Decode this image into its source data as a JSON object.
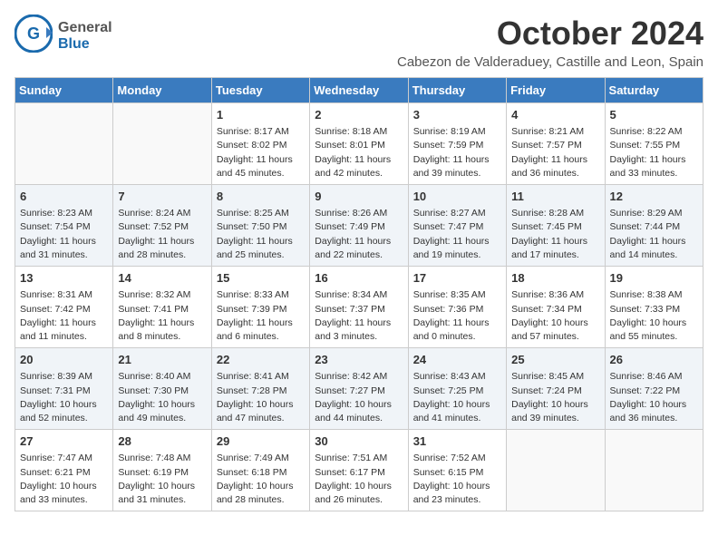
{
  "header": {
    "logo_general": "General",
    "logo_blue": "Blue",
    "title": "October 2024",
    "subtitle": "Cabezon de Valderaduey, Castille and Leon, Spain"
  },
  "days_of_week": [
    "Sunday",
    "Monday",
    "Tuesday",
    "Wednesday",
    "Thursday",
    "Friday",
    "Saturday"
  ],
  "weeks": [
    [
      {
        "day": "",
        "info": ""
      },
      {
        "day": "",
        "info": ""
      },
      {
        "day": "1",
        "info": "Sunrise: 8:17 AM\nSunset: 8:02 PM\nDaylight: 11 hours and 45 minutes."
      },
      {
        "day": "2",
        "info": "Sunrise: 8:18 AM\nSunset: 8:01 PM\nDaylight: 11 hours and 42 minutes."
      },
      {
        "day": "3",
        "info": "Sunrise: 8:19 AM\nSunset: 7:59 PM\nDaylight: 11 hours and 39 minutes."
      },
      {
        "day": "4",
        "info": "Sunrise: 8:21 AM\nSunset: 7:57 PM\nDaylight: 11 hours and 36 minutes."
      },
      {
        "day": "5",
        "info": "Sunrise: 8:22 AM\nSunset: 7:55 PM\nDaylight: 11 hours and 33 minutes."
      }
    ],
    [
      {
        "day": "6",
        "info": "Sunrise: 8:23 AM\nSunset: 7:54 PM\nDaylight: 11 hours and 31 minutes."
      },
      {
        "day": "7",
        "info": "Sunrise: 8:24 AM\nSunset: 7:52 PM\nDaylight: 11 hours and 28 minutes."
      },
      {
        "day": "8",
        "info": "Sunrise: 8:25 AM\nSunset: 7:50 PM\nDaylight: 11 hours and 25 minutes."
      },
      {
        "day": "9",
        "info": "Sunrise: 8:26 AM\nSunset: 7:49 PM\nDaylight: 11 hours and 22 minutes."
      },
      {
        "day": "10",
        "info": "Sunrise: 8:27 AM\nSunset: 7:47 PM\nDaylight: 11 hours and 19 minutes."
      },
      {
        "day": "11",
        "info": "Sunrise: 8:28 AM\nSunset: 7:45 PM\nDaylight: 11 hours and 17 minutes."
      },
      {
        "day": "12",
        "info": "Sunrise: 8:29 AM\nSunset: 7:44 PM\nDaylight: 11 hours and 14 minutes."
      }
    ],
    [
      {
        "day": "13",
        "info": "Sunrise: 8:31 AM\nSunset: 7:42 PM\nDaylight: 11 hours and 11 minutes."
      },
      {
        "day": "14",
        "info": "Sunrise: 8:32 AM\nSunset: 7:41 PM\nDaylight: 11 hours and 8 minutes."
      },
      {
        "day": "15",
        "info": "Sunrise: 8:33 AM\nSunset: 7:39 PM\nDaylight: 11 hours and 6 minutes."
      },
      {
        "day": "16",
        "info": "Sunrise: 8:34 AM\nSunset: 7:37 PM\nDaylight: 11 hours and 3 minutes."
      },
      {
        "day": "17",
        "info": "Sunrise: 8:35 AM\nSunset: 7:36 PM\nDaylight: 11 hours and 0 minutes."
      },
      {
        "day": "18",
        "info": "Sunrise: 8:36 AM\nSunset: 7:34 PM\nDaylight: 10 hours and 57 minutes."
      },
      {
        "day": "19",
        "info": "Sunrise: 8:38 AM\nSunset: 7:33 PM\nDaylight: 10 hours and 55 minutes."
      }
    ],
    [
      {
        "day": "20",
        "info": "Sunrise: 8:39 AM\nSunset: 7:31 PM\nDaylight: 10 hours and 52 minutes."
      },
      {
        "day": "21",
        "info": "Sunrise: 8:40 AM\nSunset: 7:30 PM\nDaylight: 10 hours and 49 minutes."
      },
      {
        "day": "22",
        "info": "Sunrise: 8:41 AM\nSunset: 7:28 PM\nDaylight: 10 hours and 47 minutes."
      },
      {
        "day": "23",
        "info": "Sunrise: 8:42 AM\nSunset: 7:27 PM\nDaylight: 10 hours and 44 minutes."
      },
      {
        "day": "24",
        "info": "Sunrise: 8:43 AM\nSunset: 7:25 PM\nDaylight: 10 hours and 41 minutes."
      },
      {
        "day": "25",
        "info": "Sunrise: 8:45 AM\nSunset: 7:24 PM\nDaylight: 10 hours and 39 minutes."
      },
      {
        "day": "26",
        "info": "Sunrise: 8:46 AM\nSunset: 7:22 PM\nDaylight: 10 hours and 36 minutes."
      }
    ],
    [
      {
        "day": "27",
        "info": "Sunrise: 7:47 AM\nSunset: 6:21 PM\nDaylight: 10 hours and 33 minutes."
      },
      {
        "day": "28",
        "info": "Sunrise: 7:48 AM\nSunset: 6:19 PM\nDaylight: 10 hours and 31 minutes."
      },
      {
        "day": "29",
        "info": "Sunrise: 7:49 AM\nSunset: 6:18 PM\nDaylight: 10 hours and 28 minutes."
      },
      {
        "day": "30",
        "info": "Sunrise: 7:51 AM\nSunset: 6:17 PM\nDaylight: 10 hours and 26 minutes."
      },
      {
        "day": "31",
        "info": "Sunrise: 7:52 AM\nSunset: 6:15 PM\nDaylight: 10 hours and 23 minutes."
      },
      {
        "day": "",
        "info": ""
      },
      {
        "day": "",
        "info": ""
      }
    ]
  ]
}
